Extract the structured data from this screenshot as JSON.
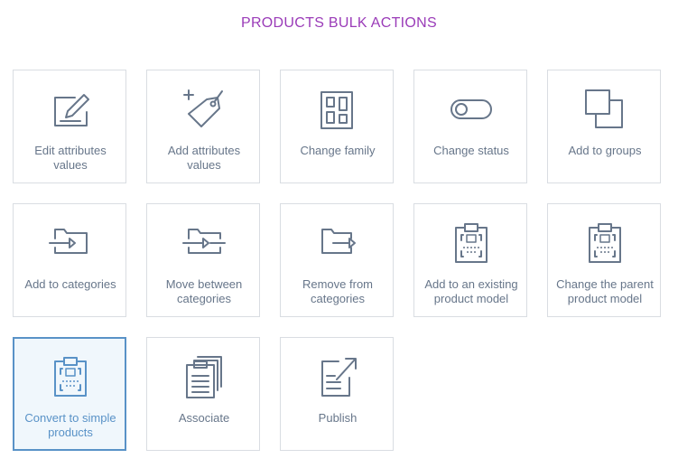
{
  "page": {
    "title": "PRODUCTS BULK ACTIONS"
  },
  "colors": {
    "title": "#9a3bb8",
    "icon": "#67768a",
    "label": "#67768a",
    "selected": "#5992c7",
    "selected_background": "#f0f7fc",
    "border": "#d9dde2"
  },
  "actions": [
    {
      "label": "Edit attributes values",
      "icon": "edit-icon"
    },
    {
      "label": "Add attributes values",
      "icon": "tag-plus-icon"
    },
    {
      "label": "Change family",
      "icon": "family-icon"
    },
    {
      "label": "Change status",
      "icon": "toggle-icon"
    },
    {
      "label": "Add to groups",
      "icon": "groups-icon"
    },
    {
      "label": "Add to categories",
      "icon": "folder-in-icon"
    },
    {
      "label": "Move between categories",
      "icon": "folder-move-icon"
    },
    {
      "label": "Remove from categories",
      "icon": "folder-out-icon"
    },
    {
      "label": "Add to an existing product model",
      "icon": "product-model-icon"
    },
    {
      "label": "Change the parent product model",
      "icon": "product-model-icon"
    },
    {
      "label": "Convert to simple products",
      "icon": "product-model-icon",
      "selected": true
    },
    {
      "label": "Associate",
      "icon": "associate-icon"
    },
    {
      "label": "Publish",
      "icon": "publish-icon"
    }
  ]
}
